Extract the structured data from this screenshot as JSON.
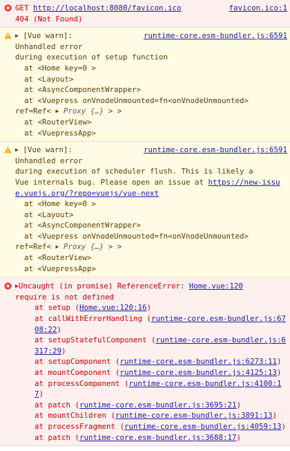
{
  "entry1": {
    "method": "GET",
    "url": "http://localhost:8080/favicon.ico",
    "status": "404 (Not Found)",
    "source": "favicon.ico:1"
  },
  "warn1": {
    "head": "[Vue warn]:",
    "source": "runtime-core.esm-bundler.js:6591",
    "lines": [
      "Unhandled error",
      "during execution of setup function",
      "  at <Home key=0 >",
      "  at <Layout>",
      "  at <AsyncComponentWrapper>",
      "  at <Vuepress onVnodeUnmounted=fn<onVnodeUnmounted>",
      "ref=Ref< "
    ],
    "proxy": "Proxy {…}",
    "proxy_tail": " > >",
    "tail_lines": [
      "  at <RouterView>",
      "  at <VuepressApp>"
    ]
  },
  "warn2": {
    "head": "[Vue warn]:",
    "source": "runtime-core.esm-bundler.js:6591",
    "lines": [
      "Unhandled error",
      "during execution of scheduler flush. This is likely a",
      "Vue internals bug. Please open an issue at "
    ],
    "link": "https://new-issue.vuejs.org/?repo=vuejs/vue-next",
    "mid_lines": [
      "  at <Home key=0 >",
      "  at <Layout>",
      "  at <AsyncComponentWrapper>",
      "  at <Vuepress onVnodeUnmounted=fn<onVnodeUnmounted>",
      "ref=Ref< "
    ],
    "proxy": "Proxy {…}",
    "proxy_tail": " > >",
    "tail_lines": [
      "  at <RouterView>",
      "  at <VuepressApp>"
    ]
  },
  "uncaught": {
    "head": "Uncaught (in promise) ReferenceError:",
    "source": "Home.vue:120",
    "message": "require is not defined",
    "stack": [
      {
        "fn": "at setup (",
        "loc": "Home.vue:120:16",
        "end": ")"
      },
      {
        "fn": "at callWithErrorHandling (",
        "loc": "runtime-core.esm-bundler.js:6708:22",
        "end": ")"
      },
      {
        "fn": "at setupStatefulComponent (",
        "loc": "runtime-core.esm-bundler.js:6317:29",
        "end": ")"
      },
      {
        "fn": "at setupComponent (",
        "loc": "runtime-core.esm-bundler.js:6273:11",
        "end": ")"
      },
      {
        "fn": "at mountComponent (",
        "loc": "runtime-core.esm-bundler.js:4125:13",
        "end": ")"
      },
      {
        "fn": "at processComponent (",
        "loc": "runtime-core.esm-bundler.js:4100:17",
        "end": ")"
      },
      {
        "fn": "at patch (",
        "loc": "runtime-core.esm-bundler.js:3695:21",
        "end": ")"
      },
      {
        "fn": "at mountChildren (",
        "loc": "runtime-core.esm-bundler.js:3891:13",
        "end": ")"
      },
      {
        "fn": "at processFragment (",
        "loc": "runtime-core.esm-bundler.js:4059:13",
        "end": ")"
      },
      {
        "fn": "at patch (",
        "loc": "runtime-core.esm-bundler.js:3688:17",
        "end": ")"
      }
    ]
  },
  "colors": {
    "error": "#c80000",
    "warn": "#5c3c00",
    "link": "#1a1aa6"
  }
}
